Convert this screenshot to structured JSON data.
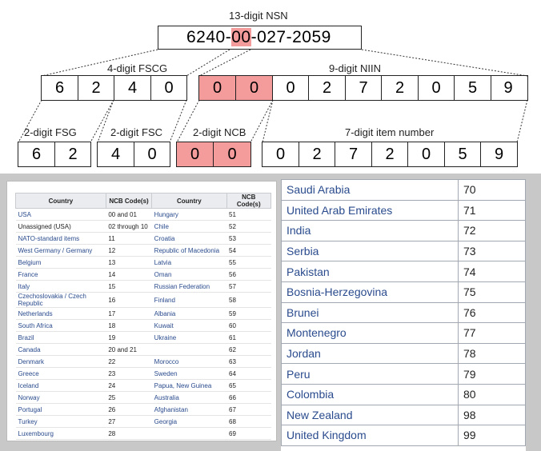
{
  "diagram": {
    "nsn_label": "13-digit NSN",
    "nsn_full": {
      "part1": "6240-",
      "part2": "00",
      "part3": "-027-2059"
    },
    "fscg_label": "4-digit FSCG",
    "niin_label": "9-digit NIIN",
    "fscg_digits": [
      "6",
      "2",
      "4",
      "0"
    ],
    "niin_digits": [
      "0",
      "0",
      "0",
      "2",
      "7",
      "2",
      "0",
      "5",
      "9"
    ],
    "fsg_label": "2-digit FSG",
    "fsc_label": "2-digit FSC",
    "ncb_label": "2-digit NCB",
    "item_label": "7-digit item number",
    "fsg_digits": [
      "6",
      "2"
    ],
    "fsc_digits": [
      "4",
      "0"
    ],
    "ncb_digits": [
      "0",
      "0"
    ],
    "item_digits": [
      "0",
      "2",
      "7",
      "2",
      "0",
      "5",
      "9"
    ],
    "highlight_color": "#f49b9b"
  },
  "small_table": {
    "headers": [
      "Country",
      "NCB Code(s)",
      "Country",
      "NCB Code(s)"
    ],
    "rows": [
      [
        "USA",
        "00 and 01",
        "Hungary",
        "51"
      ],
      [
        "Unassigned (USA)",
        "02 through 10",
        "Chile",
        "52"
      ],
      [
        "NATO-standard items",
        "11",
        "Croatia",
        "53"
      ],
      [
        "West Germany / Germany",
        "12",
        "Republic of Macedonia",
        "54"
      ],
      [
        "Belgium",
        "13",
        "Latvia",
        "55"
      ],
      [
        "France",
        "14",
        "Oman",
        "56"
      ],
      [
        "Italy",
        "15",
        "Russian Federation",
        "57"
      ],
      [
        "Czechoslovakia / Czech Republic",
        "16",
        "Finland",
        "58"
      ],
      [
        "Netherlands",
        "17",
        "Albania",
        "59"
      ],
      [
        "South Africa",
        "18",
        "Kuwait",
        "60"
      ],
      [
        "Brazil",
        "19",
        "Ukraine",
        "61"
      ],
      [
        "Canada",
        "20 and 21",
        "",
        "62"
      ],
      [
        "Denmark",
        "22",
        "Morocco",
        "63"
      ],
      [
        "Greece",
        "23",
        "Sweden",
        "64"
      ],
      [
        "Iceland",
        "24",
        "Papua, New Guinea",
        "65"
      ],
      [
        "Norway",
        "25",
        "Australia",
        "66"
      ],
      [
        "Portugal",
        "26",
        "Afghanistan",
        "67"
      ],
      [
        "Turkey",
        "27",
        "Georgia",
        "68"
      ],
      [
        "Luxembourg",
        "28",
        "",
        "69"
      ]
    ]
  },
  "big_table": {
    "rows": [
      [
        "Saudi Arabia",
        "70"
      ],
      [
        "United Arab Emirates",
        "71"
      ],
      [
        "India",
        "72"
      ],
      [
        "Serbia",
        "73"
      ],
      [
        "Pakistan",
        "74"
      ],
      [
        "Bosnia-Herzegovina",
        "75"
      ],
      [
        "Brunei",
        "76"
      ],
      [
        "Montenegro",
        "77"
      ],
      [
        "Jordan",
        "78"
      ],
      [
        "Peru",
        "79"
      ],
      [
        "Colombia",
        "80"
      ],
      [
        "New Zealand",
        "98"
      ],
      [
        "United Kingdom",
        "99"
      ]
    ]
  }
}
